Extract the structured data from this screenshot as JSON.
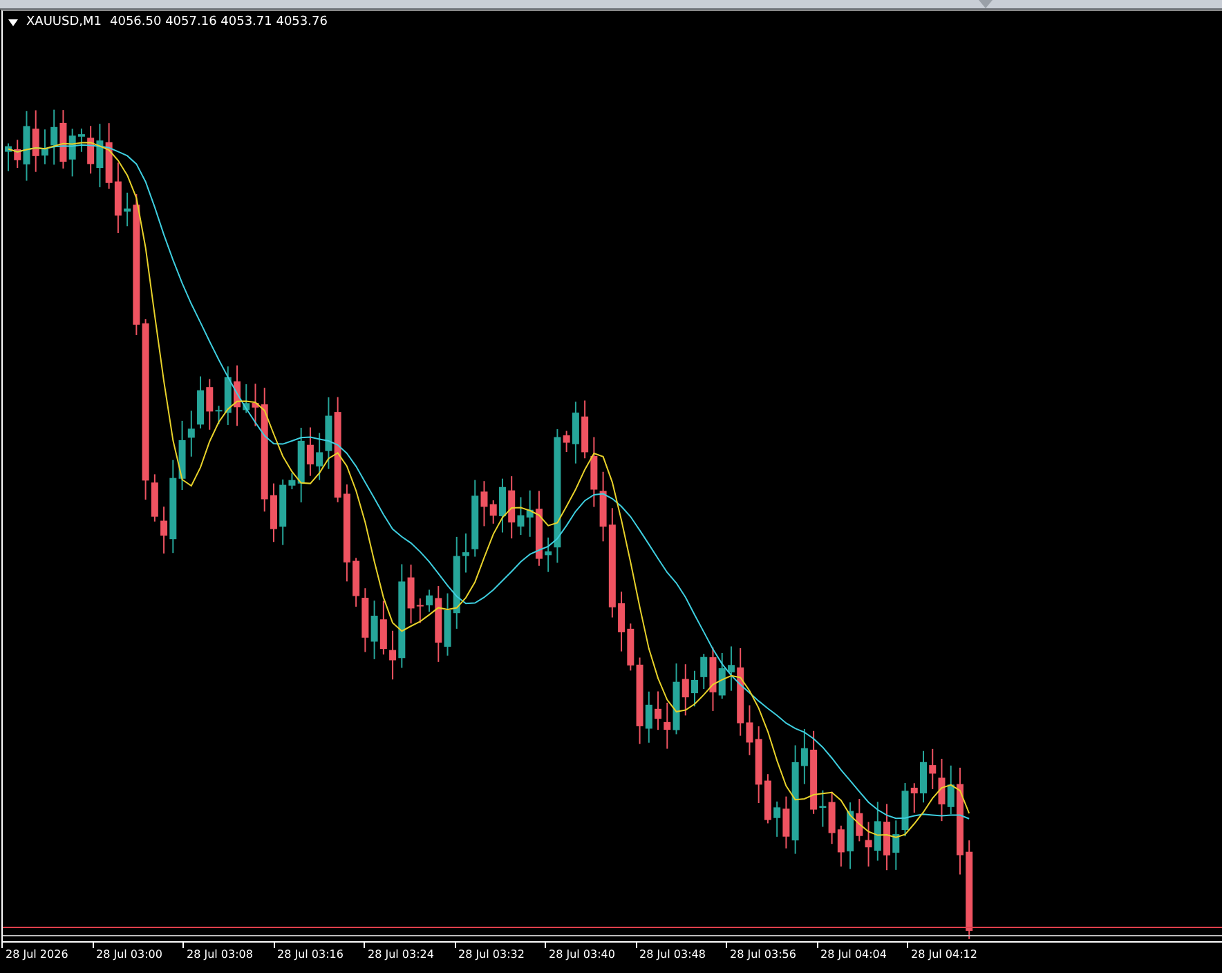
{
  "chart": {
    "symbol": "XAUUSD,M1",
    "prices": "4056.50 4057.16 4053.71 4053.76"
  },
  "time_axis": {
    "labels": [
      "28 Jul 2026",
      "28 Jul 03:00",
      "28 Jul 03:08",
      "28 Jul 03:16",
      "28 Jul 03:24",
      "28 Jul 03:32",
      "28 Jul 03:40",
      "28 Jul 03:48",
      "28 Jul 03:56",
      "28 Jul 04:04",
      "28 Jul 04:12"
    ]
  }
}
